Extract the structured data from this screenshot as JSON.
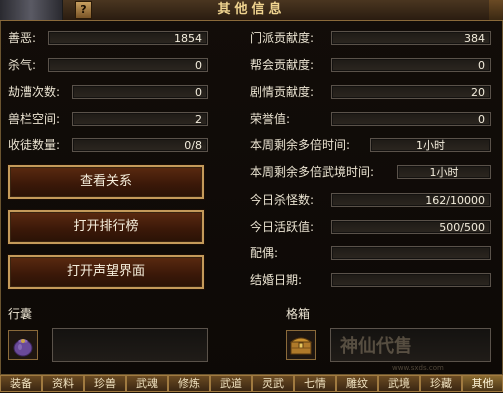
{
  "window": {
    "title": "其他信息",
    "help": "?"
  },
  "left_stats": [
    {
      "label": "善恶:",
      "value": "1854"
    },
    {
      "label": "杀气:",
      "value": "0"
    },
    {
      "label": "劫漕次数:",
      "value": "0"
    },
    {
      "label": "兽栏空间:",
      "value": "2"
    },
    {
      "label": "收徒数量:",
      "value": "0/8"
    }
  ],
  "right_stats": [
    {
      "label": "门派贡献度:",
      "value": "384"
    },
    {
      "label": "帮会贡献度:",
      "value": "0"
    },
    {
      "label": "剧情贡献度:",
      "value": "20"
    },
    {
      "label": "荣誉值:",
      "value": "0"
    },
    {
      "label": "本周剩余多倍时间:",
      "value": "1小时"
    },
    {
      "label": "本周剩余多倍武境时间:",
      "value": "1小时"
    },
    {
      "label": "今日杀怪数:",
      "value": "162/10000"
    },
    {
      "label": "今日活跃值:",
      "value": "500/500"
    },
    {
      "label": "配偶:",
      "value": ""
    },
    {
      "label": "结婚日期:",
      "value": ""
    }
  ],
  "buttons": {
    "view_relations": "查看关系",
    "open_ranking": "打开排行榜",
    "open_reputation": "打开声望界面"
  },
  "bottom": {
    "bag_label": "行囊",
    "box_label": "格箱"
  },
  "tabs": [
    "装备",
    "资料",
    "珍兽",
    "武魂",
    "修炼",
    "武道",
    "灵武",
    "七情",
    "雕纹",
    "武境",
    "珍藏",
    "其他"
  ],
  "active_tab": "其他",
  "watermark": {
    "text": "神仙代售",
    "url": "www.sxds.com"
  },
  "icons": {
    "bag": "pouch-icon",
    "box": "treasure-chest-icon"
  }
}
